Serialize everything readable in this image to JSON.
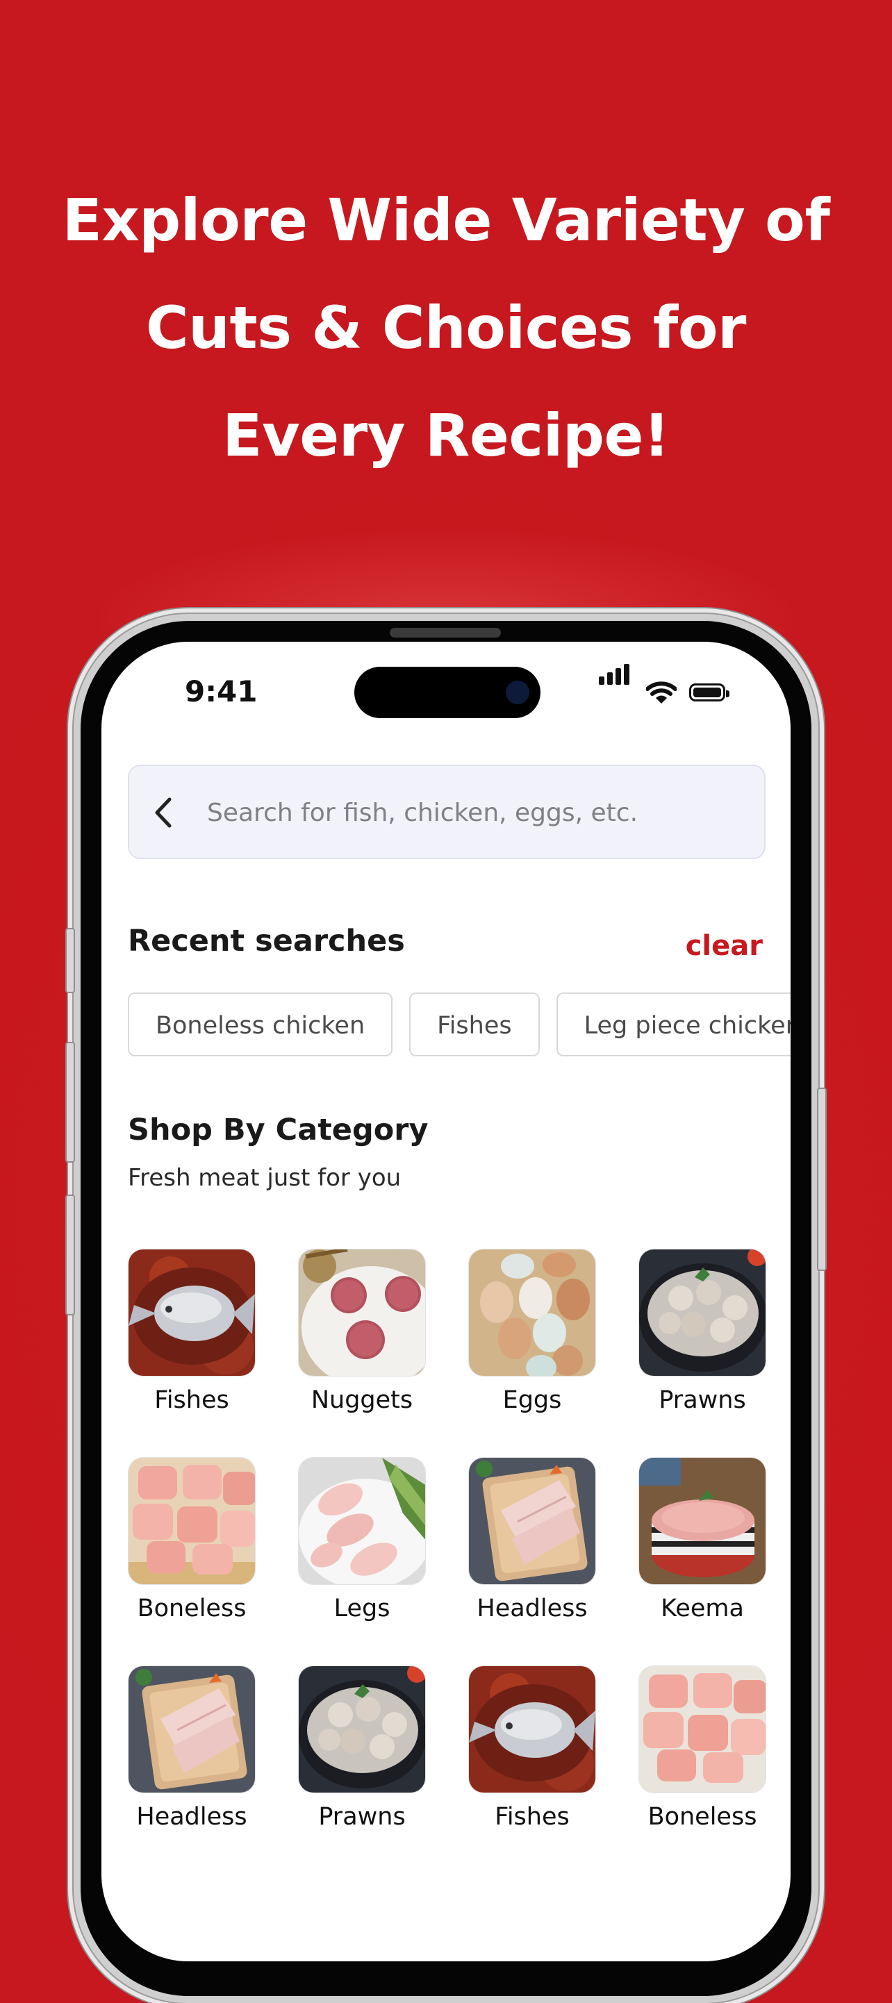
{
  "promo": {
    "headline_lines": [
      "Explore Wide Variety of",
      "Cuts & Choices for",
      "Every Recipe!"
    ]
  },
  "status_bar": {
    "time": "9:41"
  },
  "search": {
    "placeholder": "Search for fish, chicken, eggs, etc."
  },
  "recent": {
    "title": "Recent searches",
    "clear_label": "clear",
    "chips": [
      "Boneless chicken",
      "Fishes",
      "Leg piece chicken"
    ]
  },
  "category": {
    "title": "Shop By Category",
    "subtitle": "Fresh meat just for you",
    "items": [
      {
        "label": "Fishes",
        "image": "pomfret-fish"
      },
      {
        "label": "Nuggets",
        "image": "minced-patties"
      },
      {
        "label": "Eggs",
        "image": "eggs"
      },
      {
        "label": "Prawns",
        "image": "prawns-bowl"
      },
      {
        "label": "Boneless",
        "image": "chicken-cubes"
      },
      {
        "label": "Legs",
        "image": "chicken-legs"
      },
      {
        "label": "Headless",
        "image": "fish-fillet-board"
      },
      {
        "label": "Keema",
        "image": "keema-bowl"
      },
      {
        "label": "Headless",
        "image": "fish-fillet-board"
      },
      {
        "label": "Prawns",
        "image": "prawns-bowl"
      },
      {
        "label": "Fishes",
        "image": "pomfret-fish"
      },
      {
        "label": "Boneless",
        "image": "chicken-cubes"
      }
    ]
  },
  "colors": {
    "brand_red": "#c8181e",
    "search_bg": "#f2f3fa"
  }
}
